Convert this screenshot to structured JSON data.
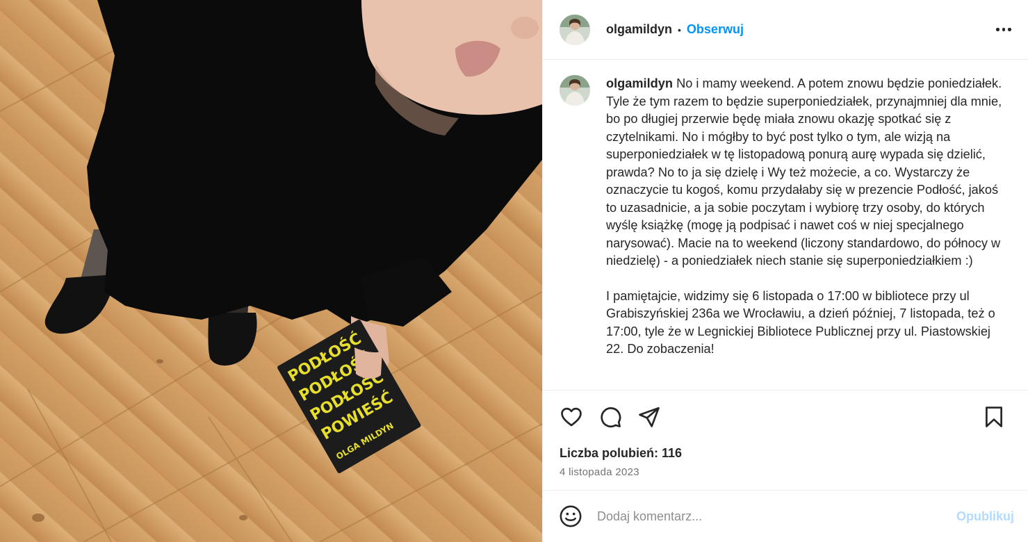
{
  "photo": {
    "alt_icon": "selfie-photo",
    "book_lines": [
      "PODŁOŚĆ",
      "PODŁOŚĆ",
      "PODŁOŚĆ",
      "POWIEŚĆ"
    ],
    "book_author": "OLGA MILDYN"
  },
  "header": {
    "username": "olgamildyn",
    "separator": "•",
    "follow_label": "Obserwuj",
    "more_icon": "more-options-icon"
  },
  "caption": {
    "username": "olgamildyn",
    "paragraph1": "No i mamy weekend. A potem znowu będzie poniedziałek. Tyle że tym razem to będzie superponiedziałek, przynajmniej dla mnie, bo po długiej przerwie będę miała znowu okazję spotkać się z czytelnikami. No i mógłby to być post tylko o tym, ale wizją na superponiedziałek w tę listopadową ponurą aurę wypada się dzielić, prawda? No to ja się dzielę i Wy też możecie, a co. Wystarczy że oznaczycie tu kogoś, komu przydałaby się w prezencie Podłość, jakoś to uzasadnicie, a ja sobie poczytam i wybiorę trzy osoby, do których wyślę książkę (mogę ją podpisać i nawet coś w niej specjalnego narysować). Macie na to weekend (liczony standardowo, do północy w niedzielę) - a poniedziałek niech stanie się superponiedziałkiem :)",
    "paragraph2": "I pamiętajcie, widzimy się 6 listopada o 17:00 w bibliotece przy ul Grabiszyńskiej 236a we Wrocławiu, a dzień później, 7 listopada, też o 17:00, tyle że w Legnickiej Bibliotece Publicznej przy ul. Piastowskiej 22. Do zobaczenia!"
  },
  "actions": {
    "like_icon": "heart-icon",
    "comment_icon": "comment-icon",
    "share_icon": "share-icon",
    "save_icon": "bookmark-icon"
  },
  "likes": {
    "label": "Liczba polubień: 116"
  },
  "date": "4 listopada 2023",
  "comment": {
    "emoji_icon": "emoji-icon",
    "placeholder": "Dodaj komentarz...",
    "publish_label": "Opublikuj"
  },
  "colors": {
    "link": "#0095f6",
    "publish_disabled": "#b3dbff",
    "text": "#262626",
    "muted": "#737373"
  }
}
